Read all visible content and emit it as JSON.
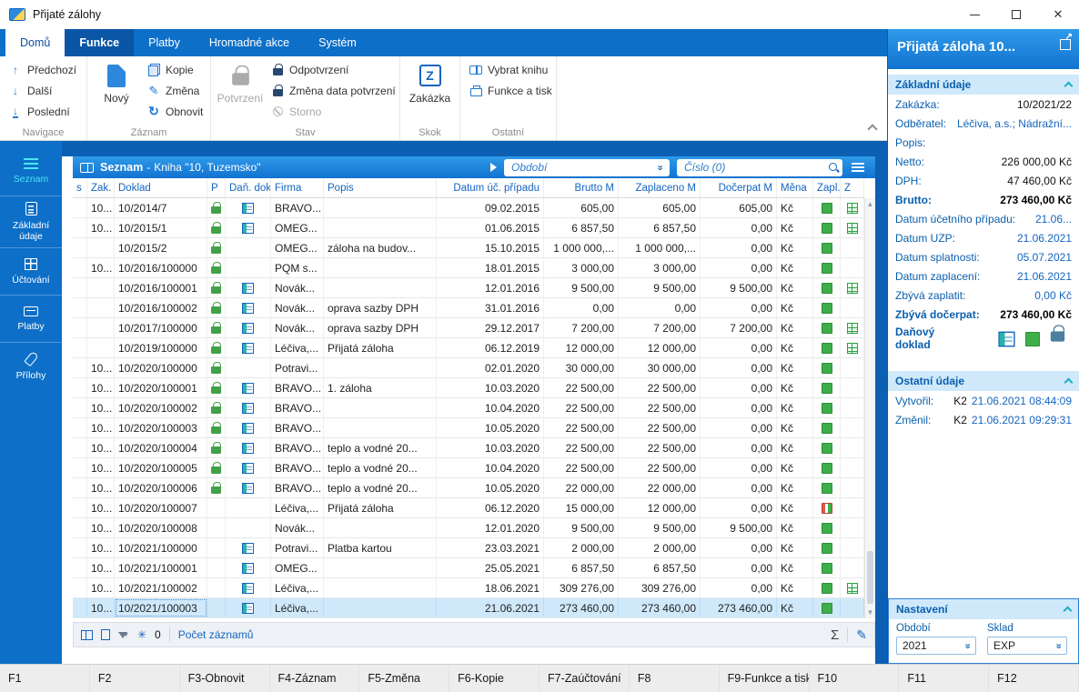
{
  "window": {
    "title": "Přijaté zálohy"
  },
  "ribbon": {
    "tabs": [
      {
        "label": "Domů",
        "state": "active"
      },
      {
        "label": "Funkce",
        "state": "dark"
      },
      {
        "label": "Platby",
        "state": ""
      },
      {
        "label": "Hromadné akce",
        "state": ""
      },
      {
        "label": "Systém",
        "state": ""
      }
    ],
    "groups": {
      "navigace": {
        "label": "Navigace",
        "prev": "Předchozí",
        "next": "Další",
        "last": "Poslední"
      },
      "zaznam": {
        "label": "Záznam",
        "novy": "Nový",
        "kopie": "Kopie",
        "zmena": "Změna",
        "obnovit": "Obnovit"
      },
      "stav": {
        "label": "Stav",
        "potvrzeni": "Potvrzení",
        "odpotvrzeni": "Odpotvrzení",
        "zmena_data": "Změna data potvrzení",
        "storno": "Storno"
      },
      "skok": {
        "label": "Skok",
        "zakazka": "Zakázka",
        "zakazka_letter": "Z"
      },
      "ostatni": {
        "label": "Ostatní",
        "vybrat_knihu": "Vybrat knihu",
        "funkce_tisk": "Funkce a tisk"
      }
    }
  },
  "sidebar": {
    "items": [
      {
        "label": "Seznam",
        "icon": "menu",
        "icon_name": "menu-icon",
        "active": true
      },
      {
        "label": "Základní údaje",
        "icon": "form",
        "icon_name": "form-icon"
      },
      {
        "label": "Účtování",
        "icon": "ledger",
        "icon_name": "ledger-icon"
      },
      {
        "label": "Platby",
        "icon": "pay",
        "icon_name": "payments-icon"
      },
      {
        "label": "Přílohy",
        "icon": "clip",
        "icon_name": "attachment-icon"
      }
    ]
  },
  "list": {
    "header": {
      "title": "Seznam",
      "sep": "-",
      "book": "Kniha \"10, Tuzemsko\""
    },
    "filters": {
      "obdobi": "Období",
      "cislo": "Číslo (0)"
    },
    "columns": [
      "s",
      "Zak.",
      "Doklad",
      "P",
      "Daň. dokl.",
      "Firma",
      "Popis",
      "Datum úč. případu",
      "Brutto M",
      "Zaplaceno M",
      "Dočerpat M",
      "Měna",
      "Zapl.",
      "Z"
    ],
    "rows": [
      {
        "zak": "10...",
        "doklad": "10/2014/7",
        "locked": true,
        "tax_doc": true,
        "firma": "BRAVO...",
        "popis": "",
        "datum": "09.02.2015",
        "brutto": "605,00",
        "zaplaceno": "605,00",
        "docerpat": "605,00",
        "mena": "Kč",
        "paid": "full",
        "z": true
      },
      {
        "zak": "10...",
        "doklad": "10/2015/1",
        "locked": true,
        "tax_doc": true,
        "firma": "OMEG...",
        "popis": "",
        "datum": "01.06.2015",
        "brutto": "6 857,50",
        "zaplaceno": "6 857,50",
        "docerpat": "0,00",
        "mena": "Kč",
        "paid": "full",
        "z": true
      },
      {
        "zak": "",
        "doklad": "10/2015/2",
        "locked": true,
        "tax_doc": false,
        "firma": "OMEG...",
        "popis": "záloha na budov...",
        "datum": "15.10.2015",
        "brutto": "1 000 000,...",
        "zaplaceno": "1 000 000,...",
        "docerpat": "0,00",
        "mena": "Kč",
        "paid": "full",
        "z": false
      },
      {
        "zak": "10...",
        "doklad": "10/2016/100000",
        "locked": true,
        "tax_doc": false,
        "firma": "PQM s...",
        "popis": "",
        "datum": "18.01.2015",
        "brutto": "3 000,00",
        "zaplaceno": "3 000,00",
        "docerpat": "0,00",
        "mena": "Kč",
        "paid": "full",
        "z": false
      },
      {
        "zak": "",
        "doklad": "10/2016/100001",
        "locked": true,
        "tax_doc": true,
        "firma": "Novák...",
        "popis": "",
        "datum": "12.01.2016",
        "brutto": "9 500,00",
        "zaplaceno": "9 500,00",
        "docerpat": "9 500,00",
        "mena": "Kč",
        "paid": "full",
        "z": true
      },
      {
        "zak": "",
        "doklad": "10/2016/100002",
        "locked": true,
        "tax_doc": true,
        "firma": "Novák...",
        "popis": "oprava sazby DPH",
        "datum": "31.01.2016",
        "brutto": "0,00",
        "zaplaceno": "0,00",
        "docerpat": "0,00",
        "mena": "Kč",
        "paid": "full",
        "z": false
      },
      {
        "zak": "",
        "doklad": "10/2017/100000",
        "locked": true,
        "tax_doc": true,
        "firma": "Novák...",
        "popis": "oprava sazby DPH",
        "datum": "29.12.2017",
        "brutto": "7 200,00",
        "zaplaceno": "7 200,00",
        "docerpat": "7 200,00",
        "mena": "Kč",
        "paid": "full",
        "z": true
      },
      {
        "zak": "",
        "doklad": "10/2019/100000",
        "locked": true,
        "tax_doc": true,
        "firma": "Léčiva,...",
        "popis": "Přijatá záloha",
        "datum": "06.12.2019",
        "brutto": "12 000,00",
        "zaplaceno": "12 000,00",
        "docerpat": "0,00",
        "mena": "Kč",
        "paid": "full",
        "z": true
      },
      {
        "zak": "10...",
        "doklad": "10/2020/100000",
        "locked": true,
        "tax_doc": false,
        "firma": "Potravi...",
        "popis": "",
        "datum": "02.01.2020",
        "brutto": "30 000,00",
        "zaplaceno": "30 000,00",
        "docerpat": "0,00",
        "mena": "Kč",
        "paid": "full",
        "z": false
      },
      {
        "zak": "10...",
        "doklad": "10/2020/100001",
        "locked": true,
        "tax_doc": true,
        "firma": "BRAVO...",
        "popis": "1. záloha",
        "datum": "10.03.2020",
        "brutto": "22 500,00",
        "zaplaceno": "22 500,00",
        "docerpat": "0,00",
        "mena": "Kč",
        "paid": "full",
        "z": false
      },
      {
        "zak": "10...",
        "doklad": "10/2020/100002",
        "locked": true,
        "tax_doc": true,
        "firma": "BRAVO...",
        "popis": "",
        "datum": "10.04.2020",
        "brutto": "22 500,00",
        "zaplaceno": "22 500,00",
        "docerpat": "0,00",
        "mena": "Kč",
        "paid": "full",
        "z": false
      },
      {
        "zak": "10...",
        "doklad": "10/2020/100003",
        "locked": true,
        "tax_doc": true,
        "firma": "BRAVO...",
        "popis": "",
        "datum": "10.05.2020",
        "brutto": "22 500,00",
        "zaplaceno": "22 500,00",
        "docerpat": "0,00",
        "mena": "Kč",
        "paid": "full",
        "z": false
      },
      {
        "zak": "10...",
        "doklad": "10/2020/100004",
        "locked": true,
        "tax_doc": true,
        "firma": "BRAVO...",
        "popis": "teplo a vodné 20...",
        "datum": "10.03.2020",
        "brutto": "22 500,00",
        "zaplaceno": "22 500,00",
        "docerpat": "0,00",
        "mena": "Kč",
        "paid": "full",
        "z": false
      },
      {
        "zak": "10...",
        "doklad": "10/2020/100005",
        "locked": true,
        "tax_doc": true,
        "firma": "BRAVO...",
        "popis": "teplo a vodné 20...",
        "datum": "10.04.2020",
        "brutto": "22 500,00",
        "zaplaceno": "22 500,00",
        "docerpat": "0,00",
        "mena": "Kč",
        "paid": "full",
        "z": false
      },
      {
        "zak": "10...",
        "doklad": "10/2020/100006",
        "locked": true,
        "tax_doc": true,
        "firma": "BRAVO...",
        "popis": "teplo a vodné 20...",
        "datum": "10.05.2020",
        "brutto": "22 000,00",
        "zaplaceno": "22 000,00",
        "docerpat": "0,00",
        "mena": "Kč",
        "paid": "full",
        "z": false
      },
      {
        "zak": "10...",
        "doklad": "10/2020/100007",
        "locked": false,
        "tax_doc": false,
        "firma": "Léčiva,...",
        "popis": "Přijatá záloha",
        "datum": "06.12.2020",
        "brutto": "15 000,00",
        "zaplaceno": "12 000,00",
        "docerpat": "0,00",
        "mena": "Kč",
        "paid": "partial",
        "z": false
      },
      {
        "zak": "10...",
        "doklad": "10/2020/100008",
        "locked": false,
        "tax_doc": false,
        "firma": "Novák...",
        "popis": "",
        "datum": "12.01.2020",
        "brutto": "9 500,00",
        "zaplaceno": "9 500,00",
        "docerpat": "9 500,00",
        "mena": "Kč",
        "paid": "full",
        "z": false
      },
      {
        "zak": "10...",
        "doklad": "10/2021/100000",
        "locked": false,
        "tax_doc": true,
        "firma": "Potravi...",
        "popis": "Platba kartou",
        "datum": "23.03.2021",
        "brutto": "2 000,00",
        "zaplaceno": "2 000,00",
        "docerpat": "0,00",
        "mena": "Kč",
        "paid": "full",
        "z": false
      },
      {
        "zak": "10...",
        "doklad": "10/2021/100001",
        "locked": false,
        "tax_doc": true,
        "firma": "OMEG...",
        "popis": "",
        "datum": "25.05.2021",
        "brutto": "6 857,50",
        "zaplaceno": "6 857,50",
        "docerpat": "0,00",
        "mena": "Kč",
        "paid": "full",
        "z": false
      },
      {
        "zak": "10...",
        "doklad": "10/2021/100002",
        "locked": false,
        "tax_doc": true,
        "firma": "Léčiva,...",
        "popis": "",
        "datum": "18.06.2021",
        "brutto": "309 276,00",
        "zaplaceno": "309 276,00",
        "docerpat": "0,00",
        "mena": "Kč",
        "paid": "full",
        "z": true
      },
      {
        "zak": "10...",
        "doklad": "10/2021/100003",
        "locked": false,
        "tax_doc": true,
        "firma": "Léčiva,...",
        "popis": "",
        "datum": "21.06.2021",
        "brutto": "273 460,00",
        "zaplaceno": "273 460,00",
        "docerpat": "273 460,00",
        "mena": "Kč",
        "paid": "full",
        "z": false,
        "selected": true
      }
    ],
    "footer": {
      "filter_count": "0",
      "count_label": "Počet záznamů"
    }
  },
  "detail": {
    "title": "Přijatá záloha 10...",
    "sections": {
      "zakladni": {
        "title": "Základní údaje",
        "fields": [
          {
            "label": "Zakázka:",
            "value": "10/2021/22",
            "style": "plain"
          },
          {
            "label": "Odběratel:",
            "value": "Léčiva, a.s.; Nádražní...",
            "style": "link"
          },
          {
            "label": "Popis:",
            "value": "",
            "style": "plain"
          },
          {
            "label": "Netto:",
            "value": "226 000,00 Kč",
            "style": "plain"
          },
          {
            "label": "DPH:",
            "value": "47 460,00 Kč",
            "style": "plain"
          },
          {
            "label": "Brutto:",
            "value": "273 460,00 Kč",
            "style": "bold"
          },
          {
            "label": "Datum účetního případu:",
            "value": "21.06...",
            "style": "link"
          },
          {
            "label": "Datum UZP:",
            "value": "21.06.2021",
            "style": "link"
          },
          {
            "label": "Datum splatnosti:",
            "value": "05.07.2021",
            "style": "link"
          },
          {
            "label": "Datum zaplacení:",
            "value": "21.06.2021",
            "style": "link"
          },
          {
            "label": "Zbývá zaplatit:",
            "value": "0,00 Kč",
            "style": "link"
          },
          {
            "label": "Zbývá dočerpat:",
            "value": "273 460,00 Kč",
            "style": "bold"
          }
        ],
        "tax_doc_label": "Daňový doklad"
      },
      "ostatni": {
        "title": "Ostatní údaje",
        "fields": [
          {
            "label": "Vytvořil:",
            "user": "K2",
            "timestamp": "21.06.2021 08:44:09"
          },
          {
            "label": "Změnil:",
            "user": "K2",
            "timestamp": "21.06.2021 09:29:31"
          }
        ]
      },
      "nastaveni": {
        "title": "Nastavení",
        "obdobi_label": "Období",
        "obdobi_value": "2021",
        "sklad_label": "Sklad",
        "sklad_value": "EXP"
      }
    }
  },
  "fkeys": [
    "F1",
    "F2",
    "F3-Obnovit",
    "F4-Záznam",
    "F5-Změna",
    "F6-Kopie",
    "F7-Zaúčtování",
    "F8",
    "F9-Funkce a tisk",
    "F10",
    "F11",
    "F12"
  ],
  "colors": {
    "accent_blue": "#0d6fc8",
    "link_blue": "#1465c0",
    "paid_green": "#3fae49",
    "selection_blue": "#cfe9fb"
  }
}
